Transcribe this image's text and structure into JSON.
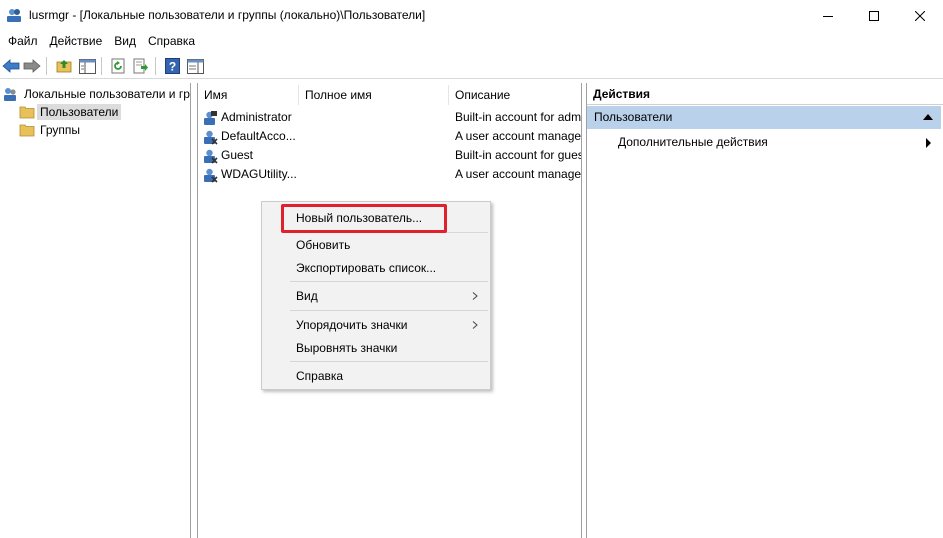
{
  "window": {
    "title": "lusrmgr - [Локальные пользователи и группы (локально)\\Пользователи]",
    "icon": "users-app-icon",
    "controls": [
      "minimize-icon",
      "maximize-icon",
      "close-icon"
    ]
  },
  "menubar": {
    "items": [
      "Файл",
      "Действие",
      "Вид",
      "Справка"
    ]
  },
  "toolbar": {
    "buttons": [
      "back-icon",
      "forward-icon",
      "up-folder-icon",
      "show-hide-tree-icon",
      "refresh-icon",
      "export-list-icon",
      "help-icon",
      "show-hide-action-pane-icon"
    ]
  },
  "tree": {
    "root": "Локальные пользователи и группы (локально)",
    "items": [
      "Пользователи",
      "Группы"
    ],
    "selected": "Пользователи"
  },
  "list": {
    "columns": [
      "Имя",
      "Полное имя",
      "Описание"
    ],
    "rows": [
      {
        "name": "Administrator",
        "full_name": "",
        "description": "Built-in account for administering the computer/domain"
      },
      {
        "name": "DefaultAcco...",
        "full_name": "",
        "description": "A user account managed by the system."
      },
      {
        "name": "Guest",
        "full_name": "",
        "description": "Built-in account for guest access to the computer/domain"
      },
      {
        "name": "WDAGUtility...",
        "full_name": "",
        "description": "A user account managed and used by the system for Windows Defender Application Guard scenarios."
      }
    ]
  },
  "context_menu": {
    "items": [
      {
        "label": "Новый пользователь...",
        "submenu": false
      },
      {
        "label": "Обновить",
        "submenu": false
      },
      {
        "label": "Экспортировать список...",
        "submenu": false
      },
      {
        "label": "Вид",
        "submenu": true
      },
      {
        "label": "Упорядочить значки",
        "submenu": true
      },
      {
        "label": "Выровнять значки",
        "submenu": false
      },
      {
        "label": "Справка",
        "submenu": false
      }
    ],
    "highlight_color": "#e0202a"
  },
  "actions": {
    "header": "Действия",
    "section": "Пользователи",
    "more": "Дополнительные действия"
  },
  "colors": {
    "section_bg": "#b9d1ea",
    "selected_tree_bg": "#dcdcdc",
    "menu_bg": "#f2f2f2"
  }
}
